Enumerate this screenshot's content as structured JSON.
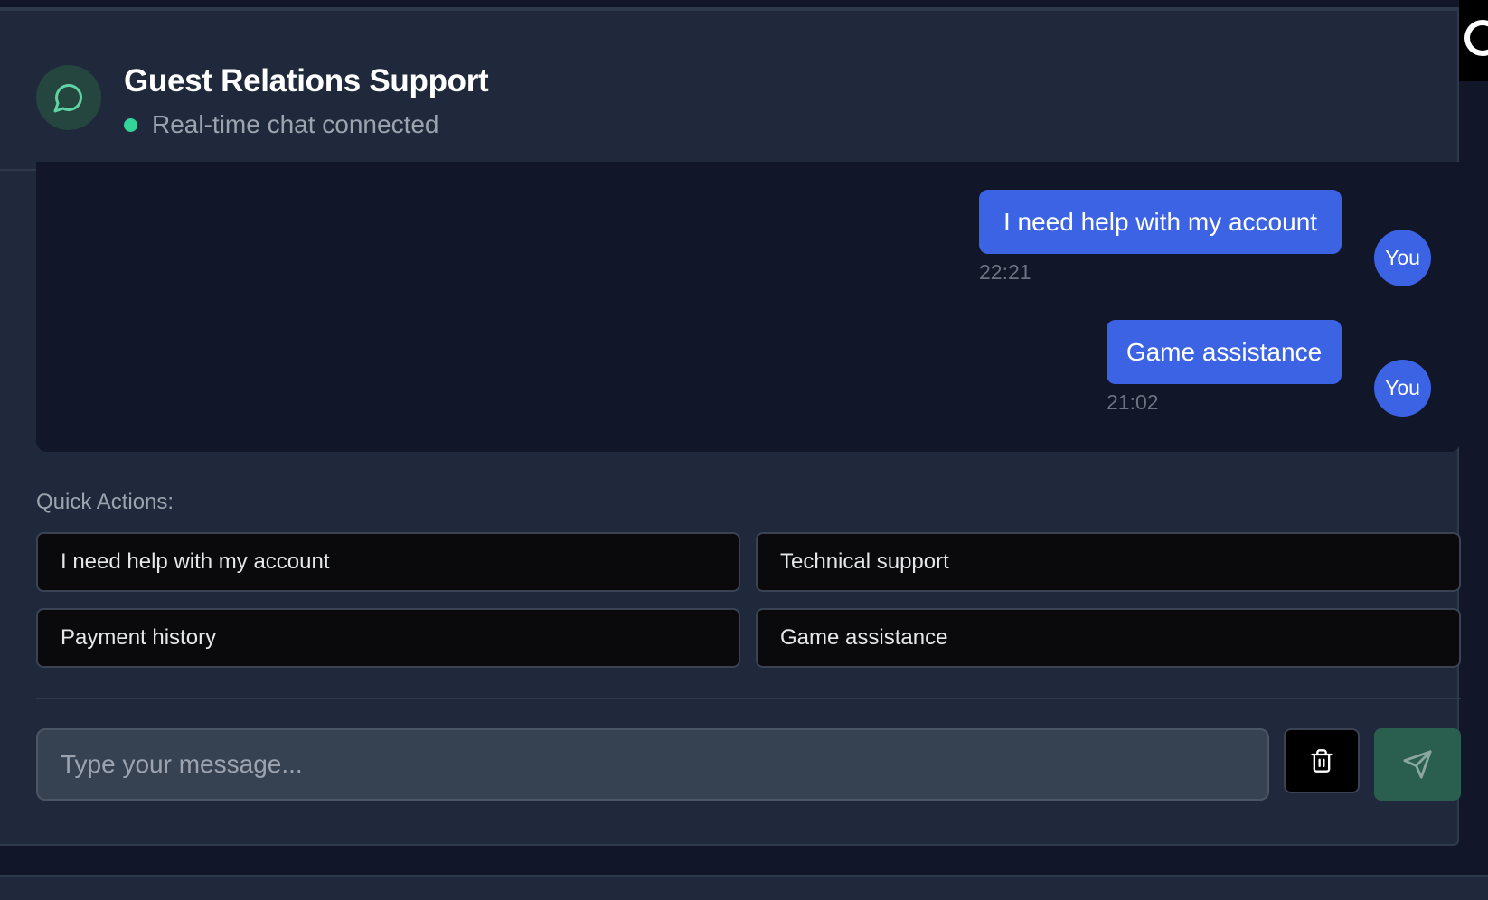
{
  "header": {
    "title": "Guest Relations Support",
    "status_text": "Real-time chat connected",
    "avatar_icon": "chat-bubble-icon"
  },
  "messages": [
    {
      "text": "I need help with my account",
      "time": "22:21",
      "sender": "You"
    },
    {
      "text": "Game assistance",
      "time": "21:02",
      "sender": "You"
    }
  ],
  "quick_actions": {
    "label": "Quick Actions:",
    "items": [
      "I need help with my account",
      "Technical support",
      "Payment history",
      "Game assistance"
    ]
  },
  "composer": {
    "placeholder": "Type your message...",
    "clear_icon": "trash-icon",
    "send_icon": "send-icon"
  },
  "colors": {
    "accent": "#3b63e4",
    "status": "#34d399",
    "send_button": "#2a5e4f",
    "panel": "#1f293b",
    "background": "#111729"
  }
}
